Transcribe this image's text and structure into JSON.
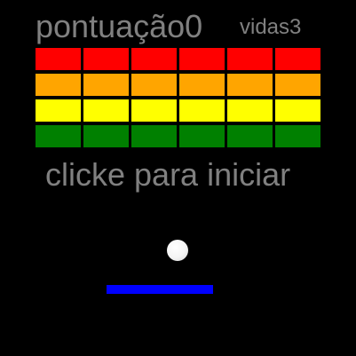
{
  "hud": {
    "score_label": "pontuação",
    "score_value": "0",
    "lives_label": "vidas",
    "lives_value": "3",
    "text_color": "#808080"
  },
  "message": {
    "start_text": "clicke para iniciar"
  },
  "bricks": {
    "columns": 6,
    "rows": [
      {
        "color": "#ff0000"
      },
      {
        "color": "#ffa500"
      },
      {
        "color": "#ffff00"
      },
      {
        "color": "#008000"
      }
    ]
  },
  "ball": {
    "color": "#ffffff",
    "icon": "ball-icon"
  },
  "paddle": {
    "color": "#0000ff"
  },
  "background_color": "#000000"
}
